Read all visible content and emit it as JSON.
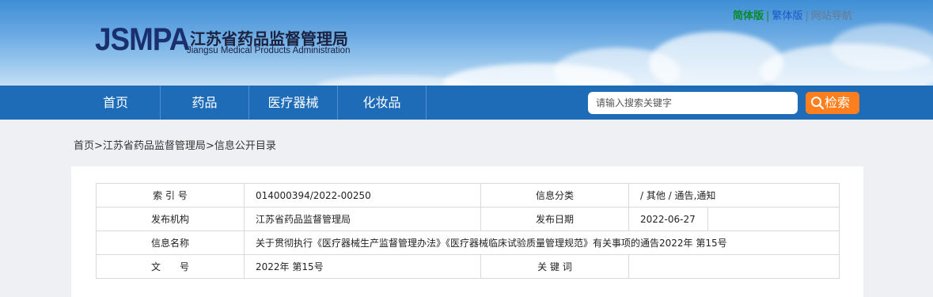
{
  "header": {
    "logo_mark": "JSMPA",
    "org_cn": "江苏省药品监督管理局",
    "org_en": "Jiangsu Medical Products Administration",
    "links": {
      "simplified": "简体版",
      "traditional": "繁体版",
      "site_nav": "网站导航",
      "sep": "|"
    }
  },
  "nav": {
    "items": [
      "首页",
      "药品",
      "医疗器械",
      "化妆品"
    ]
  },
  "search": {
    "placeholder": "请输入搜索关键字",
    "button_label": "检索"
  },
  "breadcrumb": {
    "home": "首页",
    "level1": "江苏省药品监督管理局",
    "level2": "信息公开目录",
    "sep": ">"
  },
  "info_table": {
    "index_label": "索 引 号",
    "index_value": "014000394/2022-00250",
    "category_label": "信息分类",
    "category_value": "/  其他  /  通告,通知",
    "publisher_label": "发布机构",
    "publisher_value": "江苏省药品监督管理局",
    "date_label": "发布日期",
    "date_value": "2022-06-27",
    "name_label": "信息名称",
    "name_value": "关于贯彻执行《医疗器械生产监督管理办法》《医疗器械临床试验质量管理规范》有关事项的通告2022年 第15号",
    "doc_label": "文　　号",
    "doc_value": "2022年 第15号",
    "keywords_label": "关 键 词",
    "keywords_value": ""
  },
  "colors": {
    "nav_bg": "#1e6cb8",
    "search_btn": "#ff7f1f",
    "logo": "#1a2f6e",
    "simplified_link": "#0a8a2c"
  }
}
